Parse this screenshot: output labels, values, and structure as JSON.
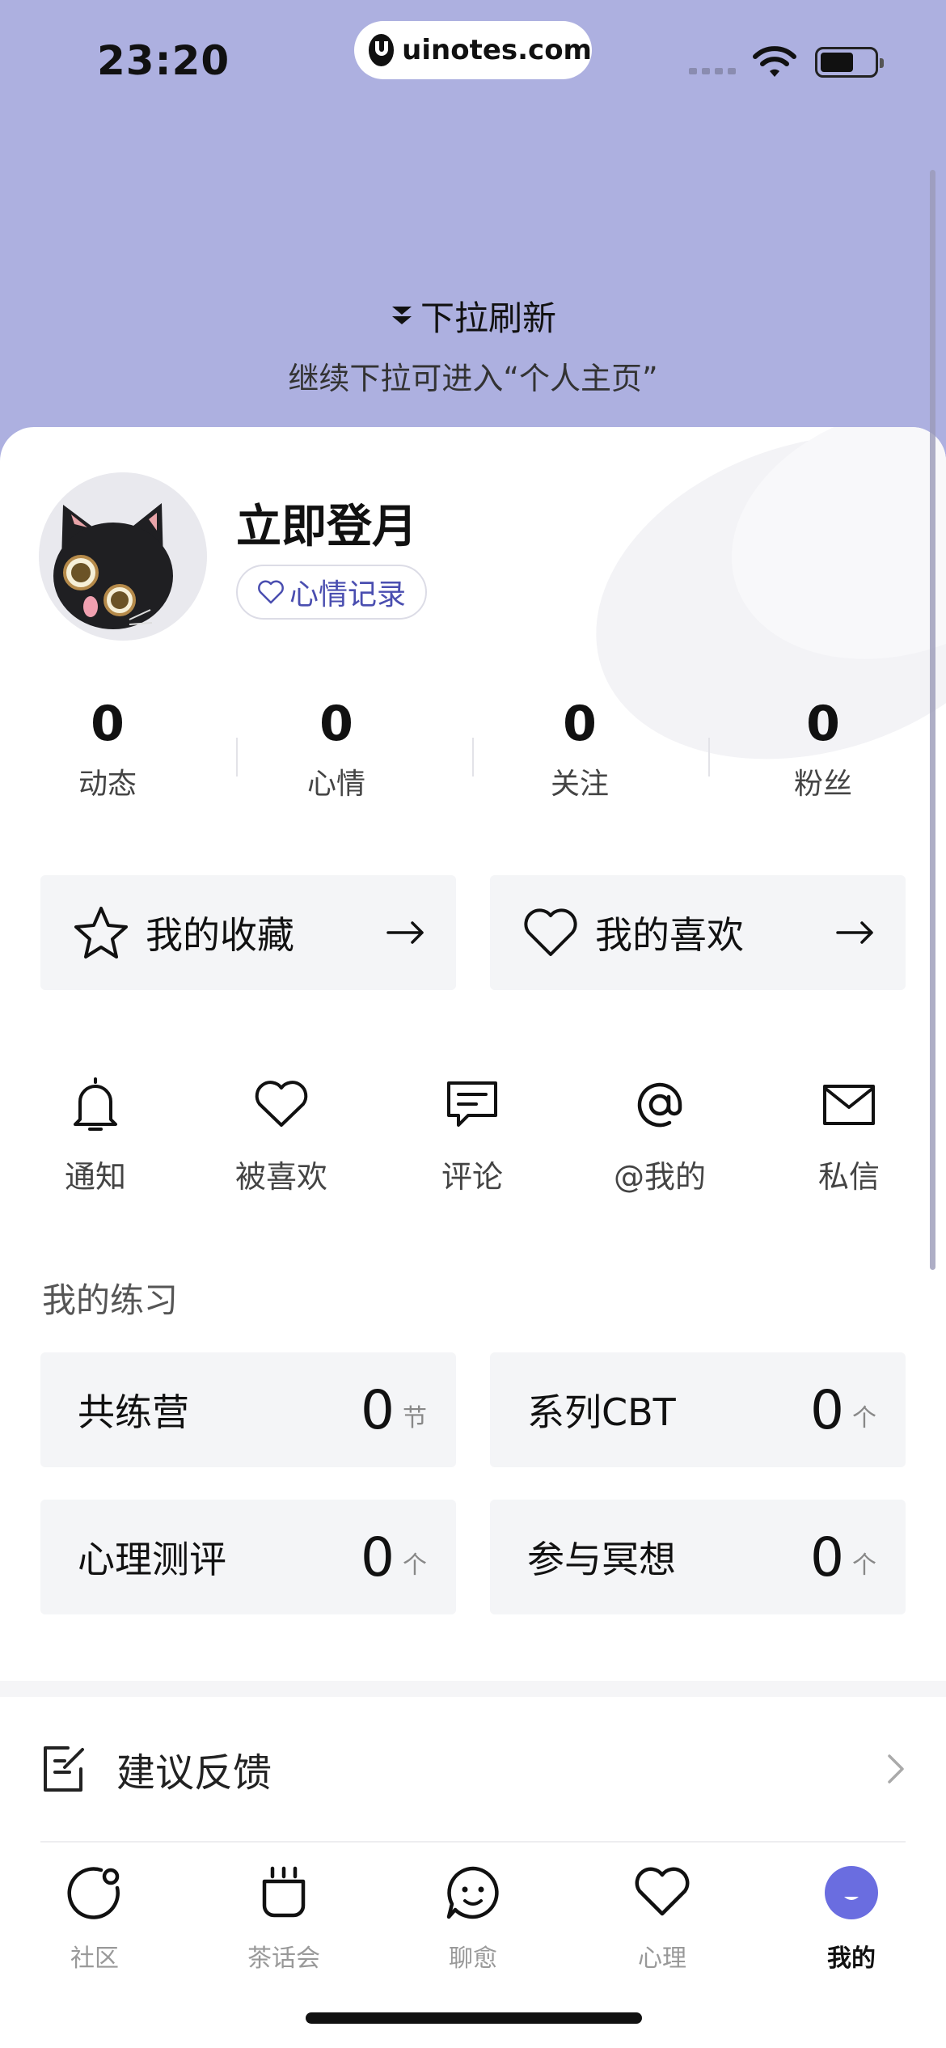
{
  "status_bar": {
    "time": "23:20",
    "url": "uinotes.com"
  },
  "pull": {
    "title": "下拉刷新",
    "hint": "继续下拉可进入“个人主页”"
  },
  "profile": {
    "name": "立即登月",
    "mood_button": "心情记录"
  },
  "stats": [
    {
      "value": "0",
      "label": "动态"
    },
    {
      "value": "0",
      "label": "心情"
    },
    {
      "value": "0",
      "label": "关注"
    },
    {
      "value": "0",
      "label": "粉丝"
    }
  ],
  "shortcuts": {
    "favorites": "我的收藏",
    "likes": "我的喜欢"
  },
  "quick_actions": [
    {
      "label": "通知",
      "icon": "bell-icon"
    },
    {
      "label": "被喜欢",
      "icon": "heart-icon"
    },
    {
      "label": "评论",
      "icon": "comment-icon"
    },
    {
      "label": "@我的",
      "icon": "at-icon"
    },
    {
      "label": "私信",
      "icon": "mail-icon"
    }
  ],
  "practice": {
    "title": "我的练习",
    "items": [
      {
        "label": "共练营",
        "value": "0",
        "unit": "节"
      },
      {
        "label": "系列CBT",
        "value": "0",
        "unit": "个"
      },
      {
        "label": "心理测评",
        "value": "0",
        "unit": "个"
      },
      {
        "label": "参与冥想",
        "value": "0",
        "unit": "个"
      }
    ]
  },
  "menu": {
    "feedback": "建议反馈"
  },
  "tabs": [
    {
      "label": "社区",
      "icon": "community-icon"
    },
    {
      "label": "茶话会",
      "icon": "tea-party-icon"
    },
    {
      "label": "聊愈",
      "icon": "chat-heal-icon"
    },
    {
      "label": "心理",
      "icon": "psychology-heart-icon"
    },
    {
      "label": "我的",
      "icon": "profile-icon",
      "active": true
    }
  ],
  "colors": {
    "header_bg": "#adb0e0",
    "accent": "#6a6de0",
    "mood_text": "#4a4eb0"
  }
}
